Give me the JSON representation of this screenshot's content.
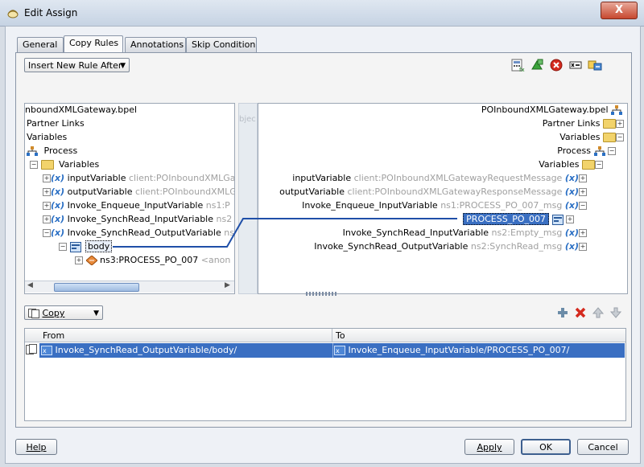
{
  "window": {
    "title": "Edit Assign",
    "close_label": "X"
  },
  "tabs": [
    {
      "label": "General"
    },
    {
      "label": "Copy Rules",
      "active": true
    },
    {
      "label": "Annotations"
    },
    {
      "label": "Skip Condition"
    }
  ],
  "rule_combo": {
    "value": "Insert New Rule After"
  },
  "middle_strip_label": "bjec",
  "source_tree": {
    "items": [
      {
        "label": "nboundXMLGateway.bpel"
      },
      {
        "label": "Partner Links"
      },
      {
        "label": "Variables"
      },
      {
        "label": "Process"
      },
      {
        "label": "Variables"
      },
      {
        "label": "inputVariable",
        "detail": "client:POInboundXMLGat"
      },
      {
        "label": "outputVariable",
        "detail": "client:POInboundXMLG"
      },
      {
        "label": "Invoke_Enqueue_InputVariable",
        "detail": "ns1:P"
      },
      {
        "label": "Invoke_SynchRead_InputVariable",
        "detail": "ns2"
      },
      {
        "label": "Invoke_SynchRead_OutputVariable",
        "detail": "ns"
      },
      {
        "label": "body"
      },
      {
        "label": "ns3:PROCESS_PO_007",
        "detail": "<anon"
      }
    ]
  },
  "target_tree": {
    "items": [
      {
        "label": "POInboundXMLGateway.bpel"
      },
      {
        "label": "Partner Links"
      },
      {
        "label": "Variables"
      },
      {
        "label": "Process"
      },
      {
        "label": "Variables"
      },
      {
        "label": "inputVariable",
        "detail": "client:POInboundXMLGatewayRequestMessage"
      },
      {
        "label": "outputVariable",
        "detail": "client:POInboundXMLGatewayResponseMessage"
      },
      {
        "label": "Invoke_Enqueue_InputVariable",
        "detail": "ns1:PROCESS_PO_007_msg"
      },
      {
        "label": "PROCESS_PO_007"
      },
      {
        "label": "Invoke_SynchRead_InputVariable",
        "detail": "ns2:Empty_msg"
      },
      {
        "label": "Invoke_SynchRead_OutputVariable",
        "detail": "ns2:SynchRead_msg"
      }
    ]
  },
  "copy_combo": {
    "value": "Copy"
  },
  "rules_table": {
    "columns": [
      "From",
      "To"
    ],
    "rows": [
      {
        "from": "Invoke_SynchRead_OutputVariable/body/",
        "to": "Invoke_Enqueue_InputVariable/PROCESS_PO_007/"
      }
    ]
  },
  "buttons": {
    "help": "Help",
    "apply": "Apply",
    "ok": "OK",
    "cancel": "Cancel"
  },
  "toolbar_icons": [
    "expression-builder-icon",
    "xml-fragment-icon",
    "remove-icon",
    "xpath-icon",
    "copy-to-clipboard-icon"
  ],
  "colors": {
    "selection": "#3a6fc2",
    "connector": "#1f4fa8"
  }
}
